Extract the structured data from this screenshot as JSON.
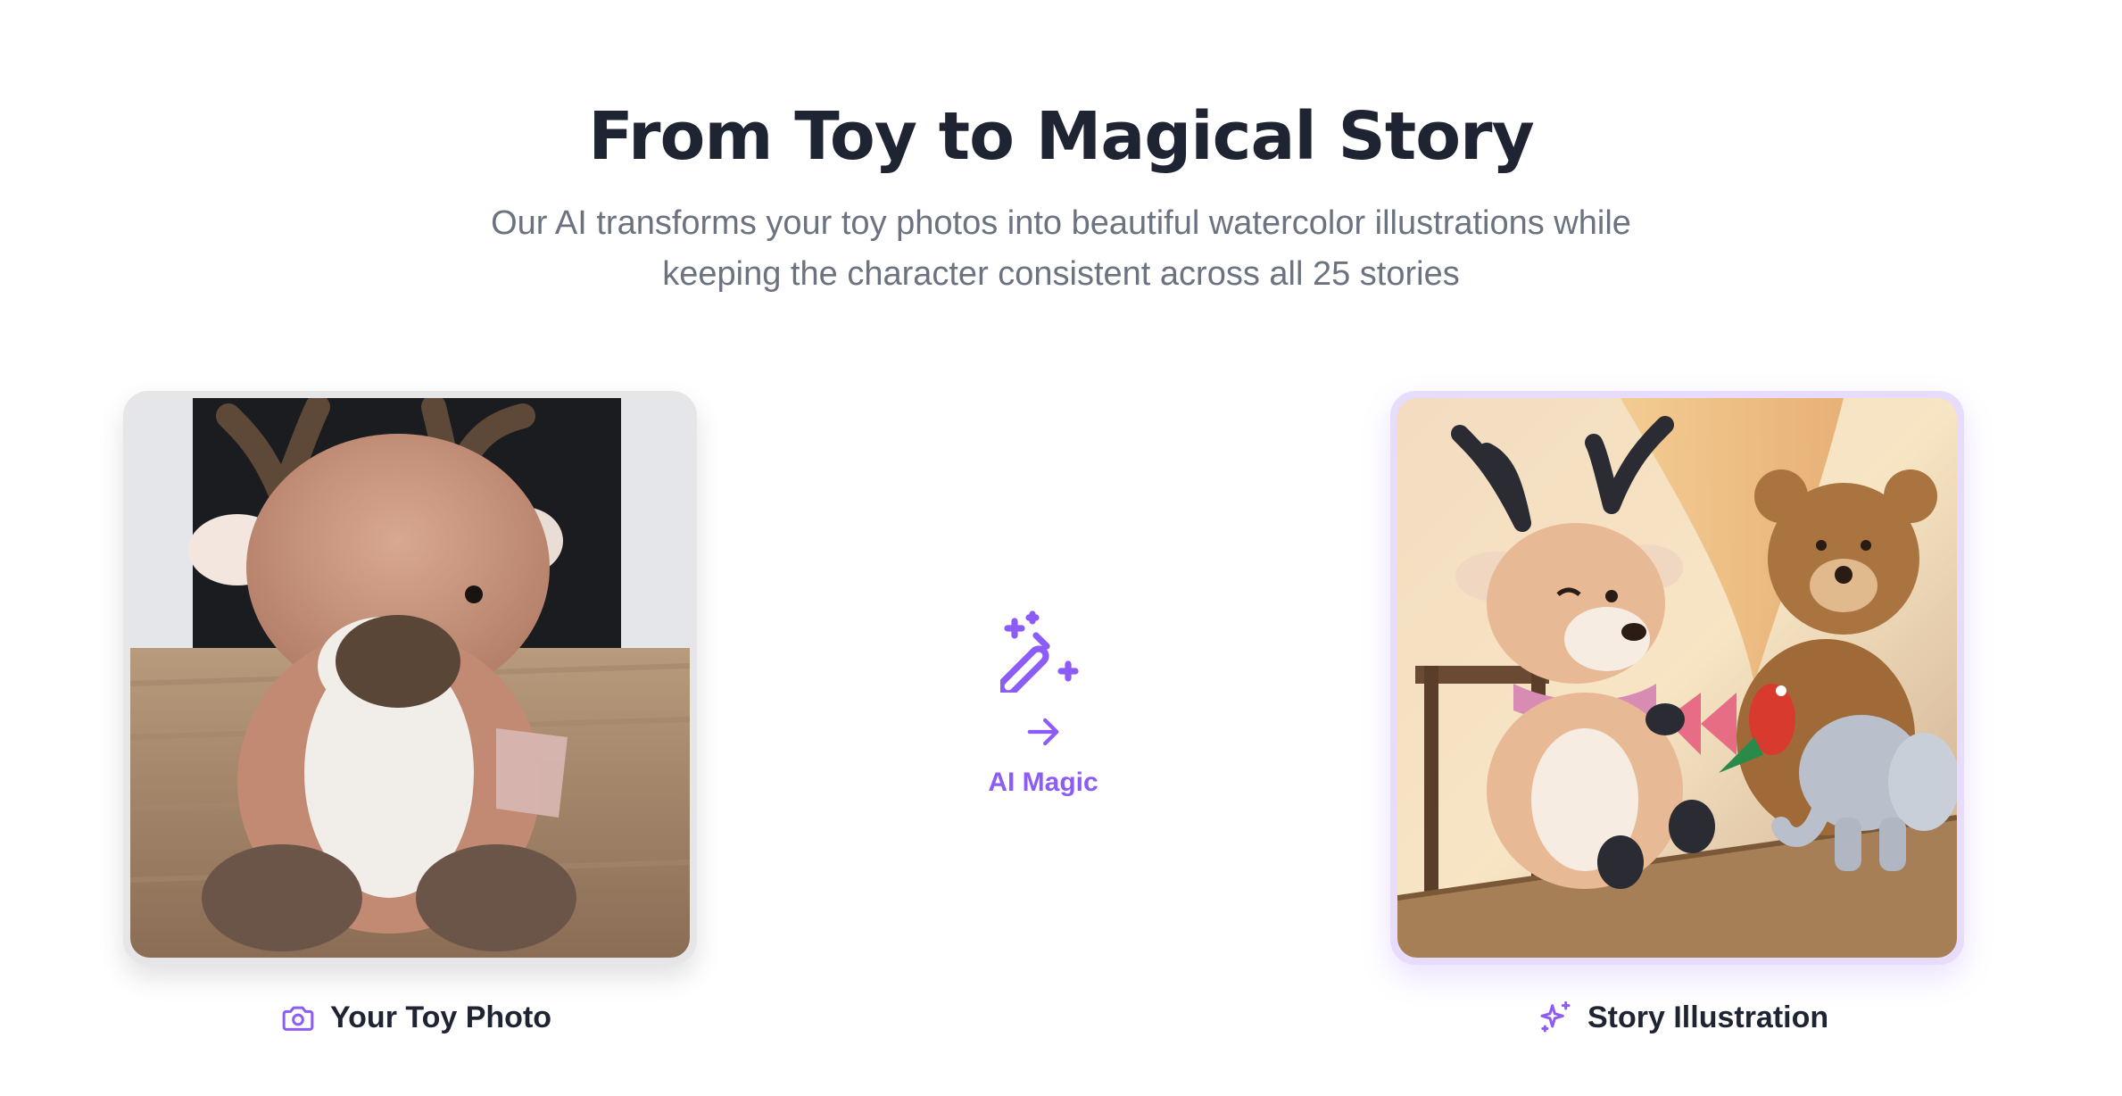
{
  "header": {
    "title": "From Toy to Magical Story",
    "subtitle_line1": "Our AI transforms your toy photos into beautiful watercolor illustrations while",
    "subtitle_line2": "keeping the character consistent across all 25 stories"
  },
  "left_card": {
    "label": "Your Toy Photo",
    "icon": "camera-icon"
  },
  "middle": {
    "caption": "AI Magic",
    "icons": [
      "magic-wand-icon",
      "arrow-right-icon"
    ]
  },
  "right_card": {
    "label": "Story Illustration",
    "icon": "sparkles-icon"
  },
  "colors": {
    "heading": "#1f2433",
    "body": "#6b7280",
    "accent": "#8b5cf6",
    "accent_border": "#e7dcfc"
  }
}
